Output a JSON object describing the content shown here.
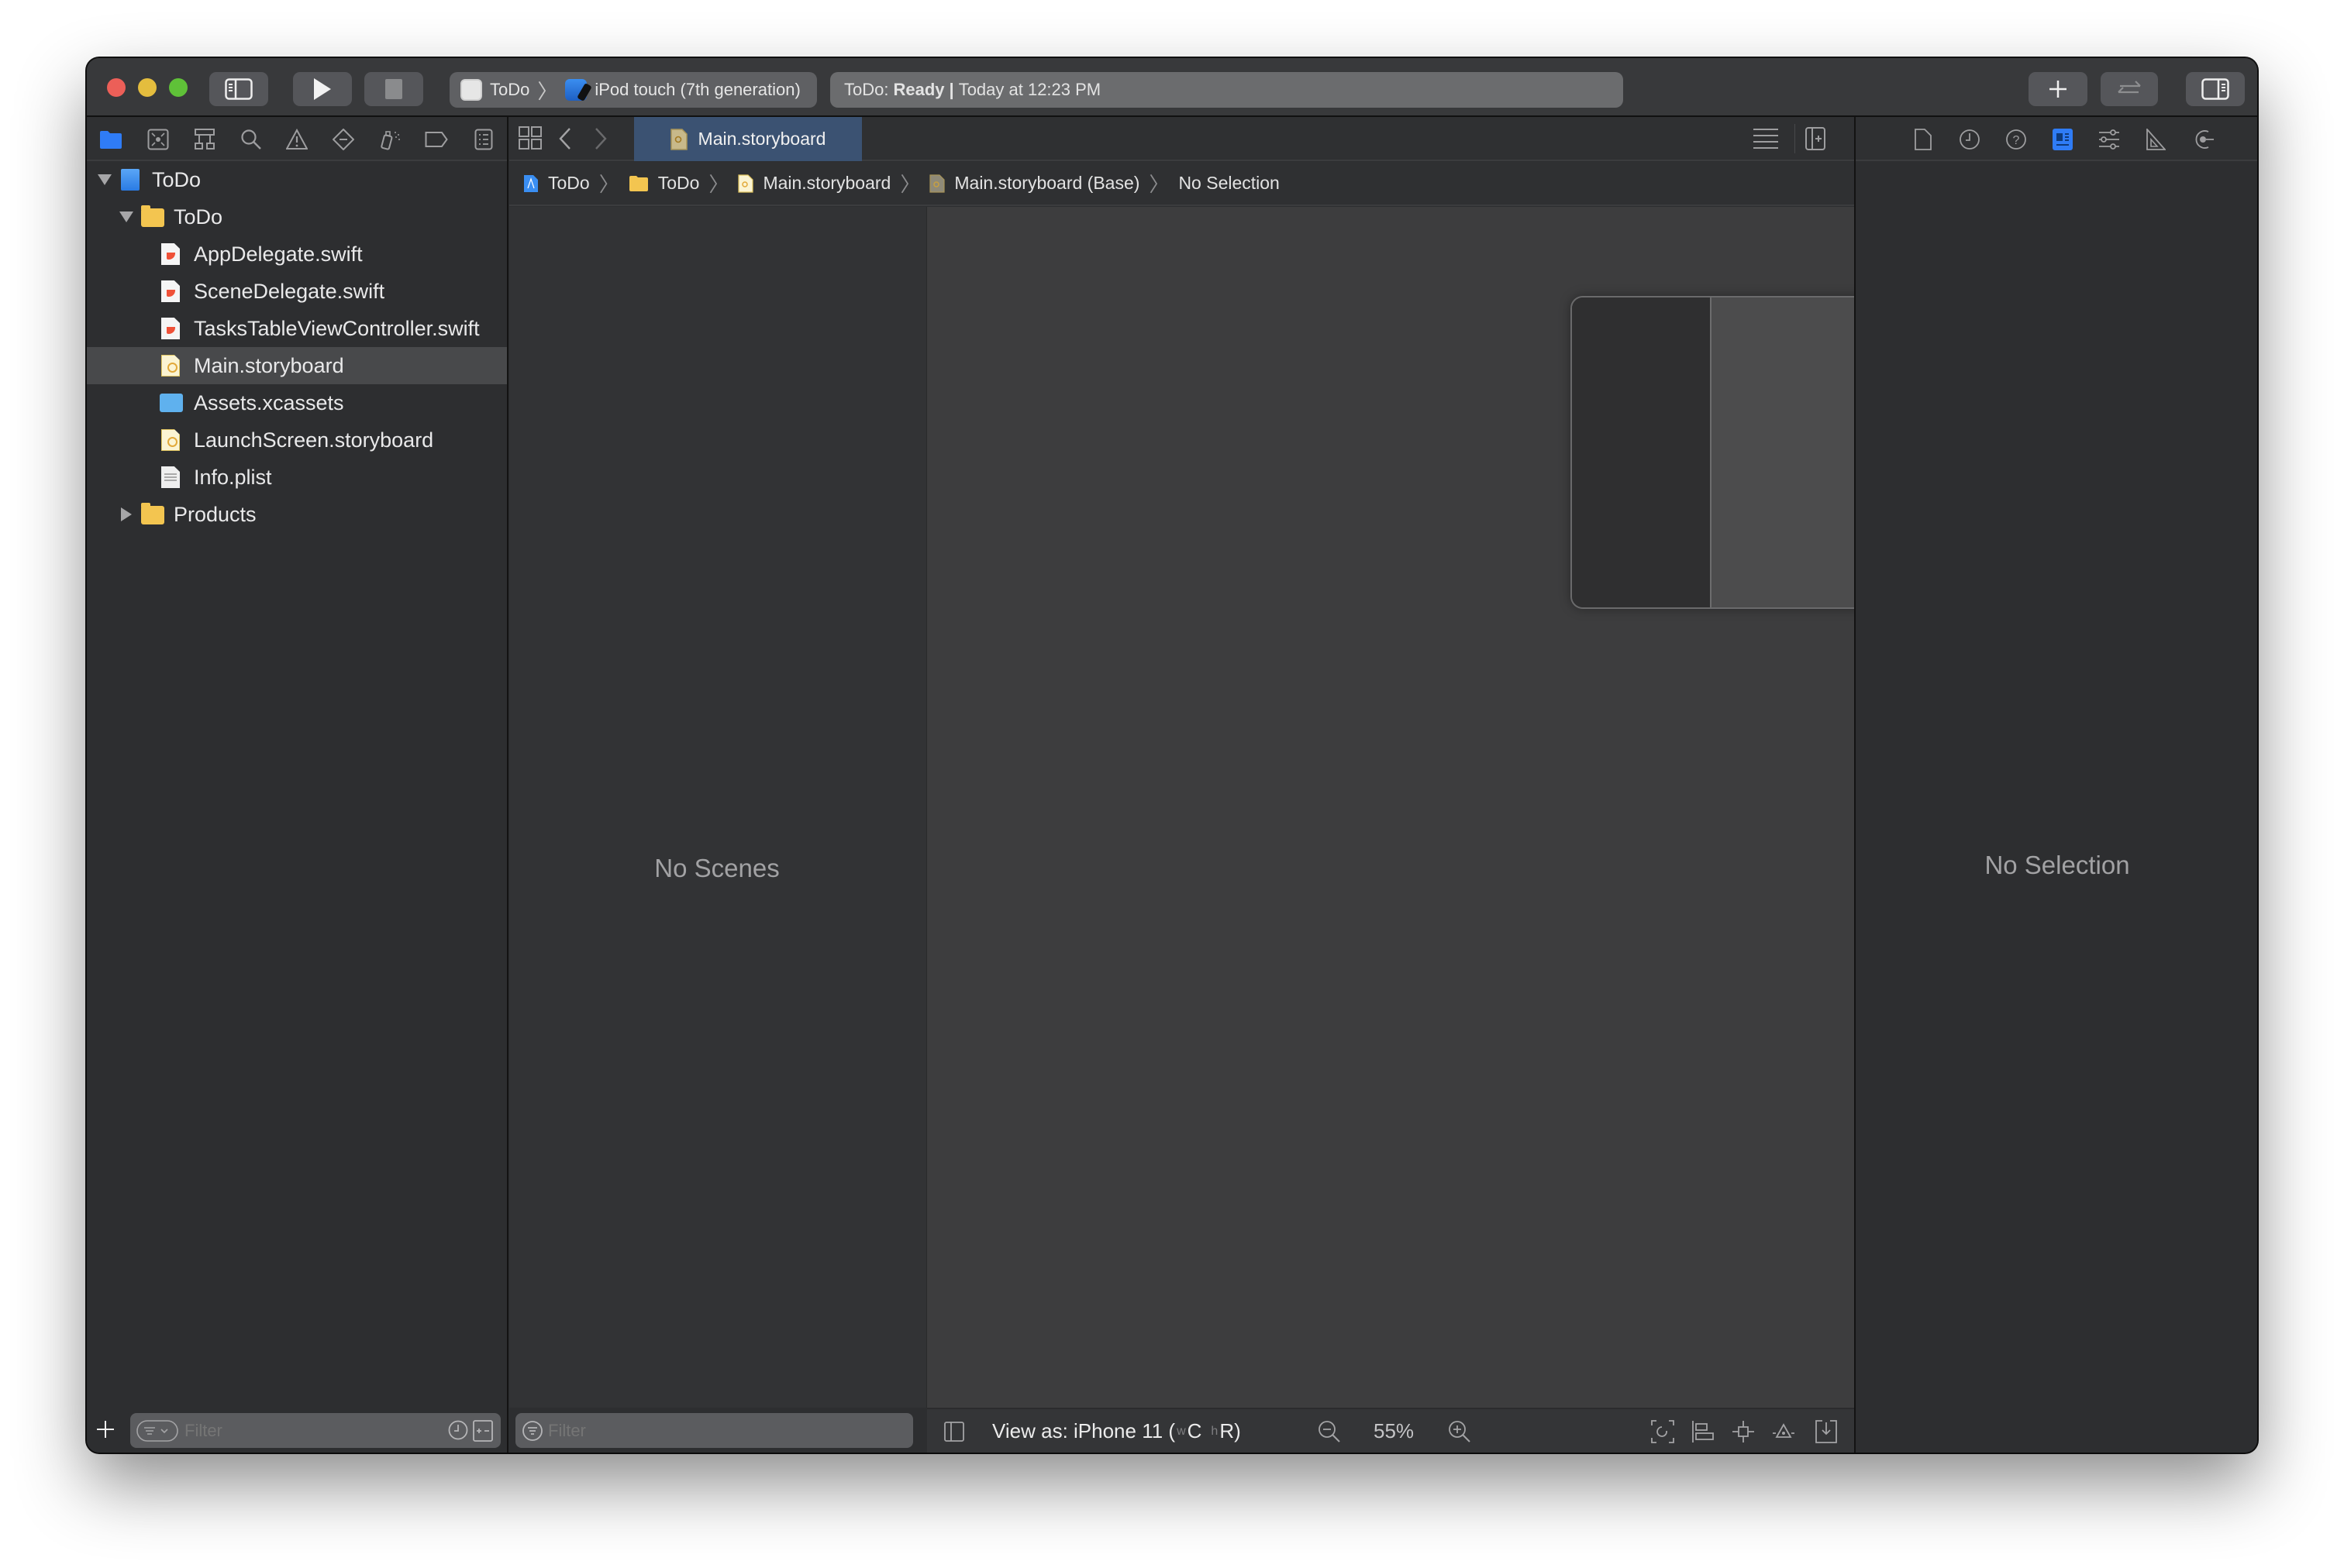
{
  "window": {
    "toolbar": {
      "scheme": {
        "project": "ToDo",
        "device": "iPod touch (7th generation)"
      },
      "status": {
        "project": "ToDo:",
        "state": "Ready",
        "separator": "|",
        "time": "Today at 12:23 PM"
      },
      "buttons": [
        "toggle-navigator",
        "run",
        "stop",
        "library-add",
        "code-review",
        "toggle-inspector"
      ]
    },
    "navigator": {
      "tabs": [
        "project-navigator",
        "source-control",
        "symbol",
        "find",
        "issue",
        "test",
        "debug",
        "breakpoint",
        "report"
      ],
      "active_tab": "project-navigator",
      "tree": [
        {
          "label": "ToDo",
          "type": "project",
          "level": 0,
          "expanded": true
        },
        {
          "label": "ToDo",
          "type": "folder",
          "level": 1,
          "expanded": true
        },
        {
          "label": "AppDelegate.swift",
          "type": "swift",
          "level": 2
        },
        {
          "label": "SceneDelegate.swift",
          "type": "swift",
          "level": 2
        },
        {
          "label": "TasksTableViewController.swift",
          "type": "swift",
          "level": 2
        },
        {
          "label": "Main.storyboard",
          "type": "storyboard",
          "level": 2,
          "selected": true
        },
        {
          "label": "Assets.xcassets",
          "type": "assets",
          "level": 2
        },
        {
          "label": "LaunchScreen.storyboard",
          "type": "storyboard",
          "level": 2
        },
        {
          "label": "Info.plist",
          "type": "plist",
          "level": 2
        },
        {
          "label": "Products",
          "type": "folder",
          "level": 1,
          "expanded": false
        }
      ],
      "filter": {
        "placeholder": "Filter"
      }
    },
    "editor": {
      "tab": {
        "label": "Main.storyboard"
      },
      "breadcrumb": [
        "ToDo",
        "ToDo",
        "Main.storyboard",
        "Main.storyboard (Base)",
        "No Selection"
      ],
      "outline": {
        "empty_text": "No Scenes",
        "filter_placeholder": "Filter"
      },
      "canvas_bar": {
        "view_as_prefix": "View as: iPhone 11 (",
        "width_class_prefix": "w",
        "width_class": "C",
        "height_class_prefix": "h",
        "height_class": "R",
        "suffix": ")",
        "zoom": "55%"
      }
    },
    "inspector": {
      "tabs": [
        "file",
        "history",
        "quick-help",
        "identity",
        "attributes",
        "size",
        "connections"
      ],
      "active_tab": "identity",
      "empty_text": "No Selection"
    },
    "colors": {
      "accent": "#2f7cf6",
      "tab_selected": "#3b5272",
      "close": "#ec5f58",
      "minimize": "#e4bd3e",
      "zoom": "#5fc138"
    }
  }
}
